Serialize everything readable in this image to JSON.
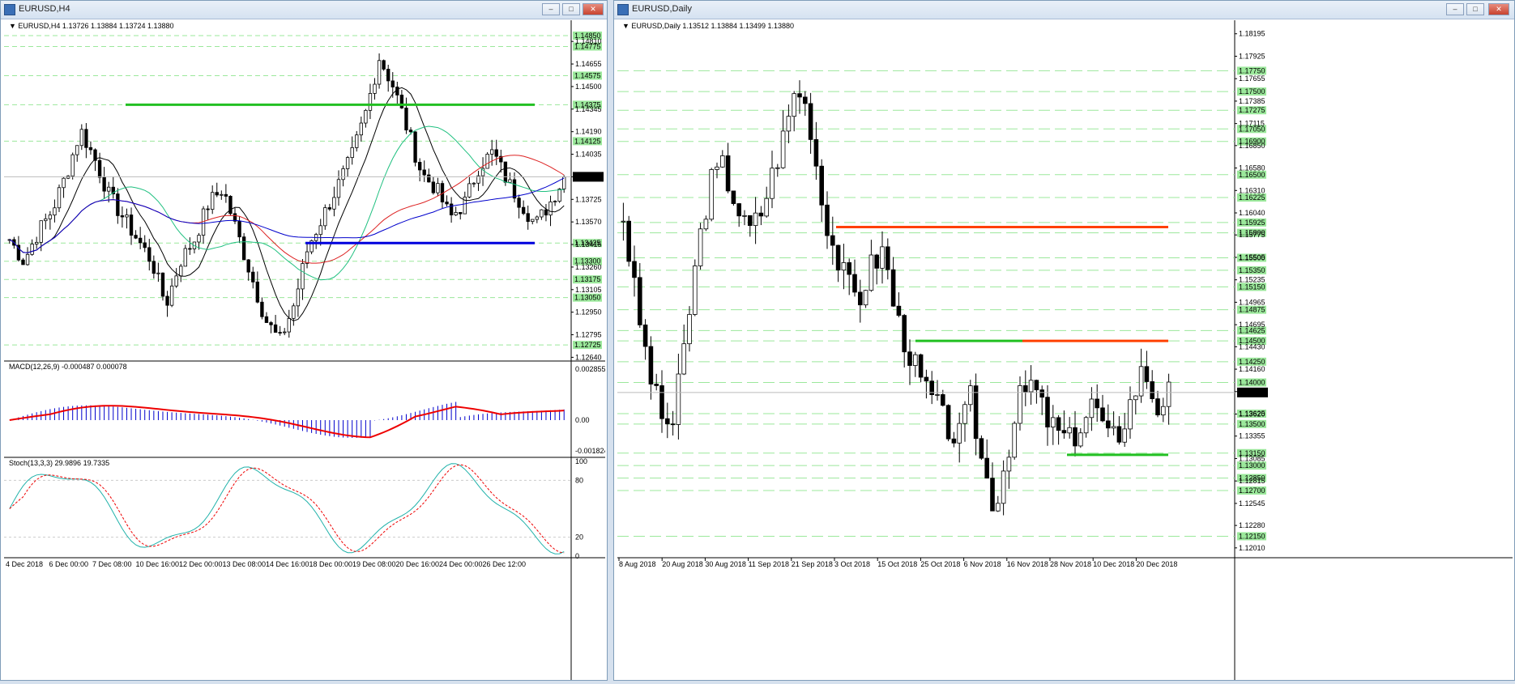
{
  "left_window": {
    "title": "EURUSD,H4",
    "header": "EURUSD,H4  1.13726 1.13884 1.13724 1.13880",
    "price_labels": [
      "1.14810",
      "1.14655",
      "1.14500",
      "1.14345",
      "1.14190",
      "1.14035",
      "1.13880",
      "1.13725",
      "1.13570",
      "1.13415",
      "1.13260",
      "1.13105",
      "1.12950",
      "1.12795",
      "1.12640"
    ],
    "green_levels": [
      "1.14850",
      "1.14775",
      "1.14575",
      "1.14375",
      "1.14125",
      "1.13425",
      "1.13300",
      "1.13175",
      "1.13050",
      "1.12725"
    ],
    "current_price": "1.13880",
    "macd_header": "MACD(12,26,9) -0.000487 0.000078",
    "macd_labels": [
      "0.002855",
      "0.00",
      "-0.001824"
    ],
    "stoch_header": "Stoch(13,3,3) 29.9896 19.7335",
    "stoch_labels": [
      "100",
      "80",
      "20",
      "0"
    ],
    "x_labels": [
      "4 Dec 2018",
      "6 Dec 00:00",
      "7 Dec 08:00",
      "10 Dec 16:00",
      "12 Dec 00:00",
      "13 Dec 08:00",
      "14 Dec 16:00",
      "18 Dec 00:00",
      "19 Dec 08:00",
      "20 Dec 16:00",
      "24 Dec 00:00",
      "26 Dec 12:00"
    ]
  },
  "right_window": {
    "title": "EURUSD,Daily",
    "header": "EURUSD,Daily  1.13512 1.13884 1.13499 1.13880",
    "price_labels": [
      "1.18195",
      "1.17925",
      "1.17655",
      "1.17385",
      "1.17115",
      "1.16850",
      "1.16580",
      "1.16310",
      "1.16040",
      "1.15775",
      "1.15505",
      "1.15235",
      "1.14965",
      "1.14695",
      "1.14430",
      "1.14160",
      "1.13890",
      "1.13620",
      "1.13355",
      "1.13085",
      "1.12815",
      "1.12545",
      "1.12280",
      "1.12010"
    ],
    "green_levels": [
      "1.17750",
      "1.17500",
      "1.17275",
      "1.17050",
      "1.16900",
      "1.16500",
      "1.16225",
      "1.15925",
      "1.15800",
      "1.15500",
      "1.15350",
      "1.15150",
      "1.14875",
      "1.14625",
      "1.14500",
      "1.14250",
      "1.14000",
      "1.13625",
      "1.13500",
      "1.13150",
      "1.13000",
      "1.12850",
      "1.12700",
      "1.12150"
    ],
    "current_price": "1.13880",
    "x_labels": [
      "8 Aug 2018",
      "20 Aug 2018",
      "30 Aug 2018",
      "11 Sep 2018",
      "21 Sep 2018",
      "3 Oct 2018",
      "15 Oct 2018",
      "25 Oct 2018",
      "6 Nov 2018",
      "16 Nov 2018",
      "28 Nov 2018",
      "10 Dec 2018",
      "20 Dec 2018"
    ]
  },
  "colors": {
    "up": "#ffffff",
    "down": "#000000",
    "grid": "#9be89b",
    "support": "#0000dd",
    "resistance": "#22c022",
    "orange": "#ff4000",
    "macd_signal": "#ee0000",
    "macd_hist": "#0000cc",
    "stoch_main": "#20b2aa",
    "stoch_signal": "#ee0000"
  }
}
